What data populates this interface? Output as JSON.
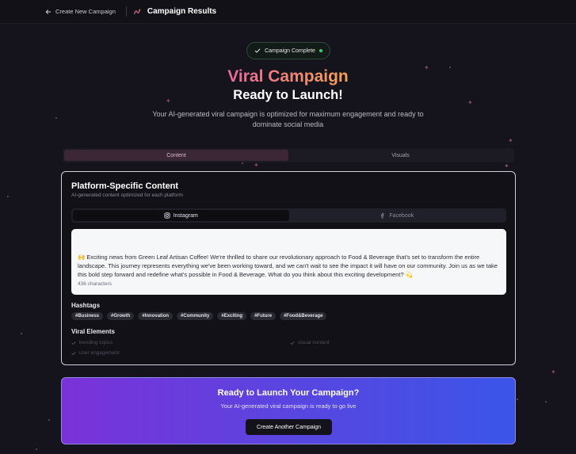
{
  "topbar": {
    "back_label": "Create New Campaign",
    "title": "Campaign Results"
  },
  "badge": {
    "label": "Campaign Complete"
  },
  "hero": {
    "line1": "Viral Campaign",
    "line2": "Ready to Launch!",
    "subtitle": "Your AI-generated viral campaign is optimized for maximum engagement and ready to dominate social media"
  },
  "main_tabs": [
    {
      "label": "Content",
      "active": true
    },
    {
      "label": "Visuals",
      "active": false
    }
  ],
  "content_card": {
    "title": "Platform-Specific Content",
    "subtitle": "AI-generated content optimized for each platform",
    "platform_tabs": [
      {
        "label": "Instagram",
        "icon": "instagram-icon",
        "active": true
      },
      {
        "label": "Facebook",
        "icon": "facebook-icon",
        "active": false
      }
    ],
    "post_text": "🙌 Exciting news from Green Leaf Artisan Coffee! We're thrilled to share our revolutionary approach to Food & Beverage that's set to transform the entire landscape. This journey represents everything we've been working toward, and we can't wait to see the impact it will have on our community. Join us as we take this bold step forward and redefine what's possible in Food & Beverage. What do you think about this exciting development? 💫",
    "char_count": "436 characters",
    "hashtags_label": "Hashtags",
    "hashtags": [
      "#Business",
      "#Growth",
      "#Innovation",
      "#Community",
      "#Exciting",
      "#Future",
      "#Food&Beverage"
    ],
    "viral_label": "Viral Elements",
    "viral_elements": [
      "trending topics",
      "visual content",
      "user engagement"
    ]
  },
  "cta": {
    "title": "Ready to Launch Your Campaign?",
    "subtitle": "Your AI-generated viral campaign is ready to go live",
    "button_label": "Create Another Campaign"
  },
  "colors": {
    "background": "#15141c",
    "accent_pink": "#e86aa0",
    "accent_orange": "#f5a256",
    "success_green": "#34d07a",
    "cta_purple": "#7a32d8",
    "cta_blue": "#3b55e8"
  }
}
